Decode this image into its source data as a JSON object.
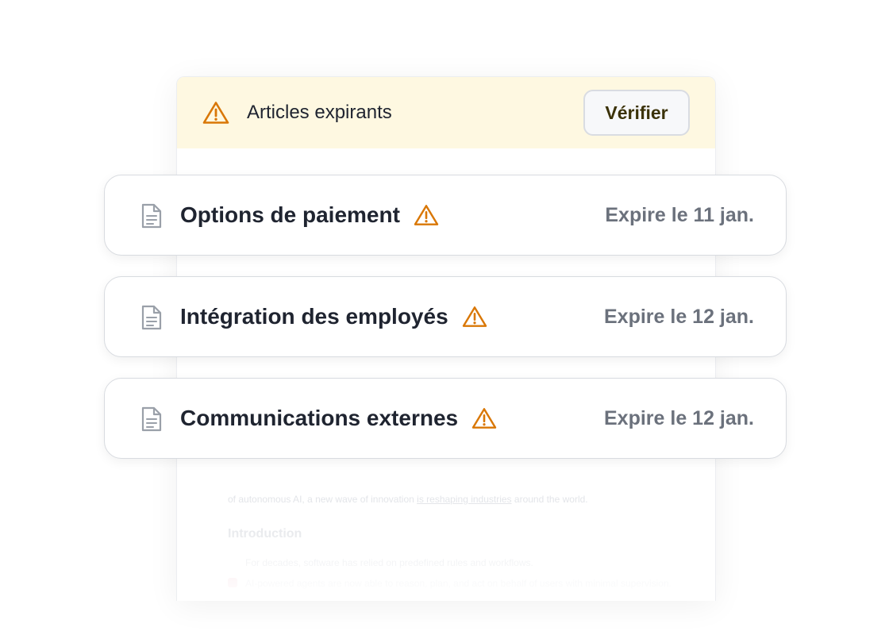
{
  "banner": {
    "title": "Articles expirants",
    "icon": "warning-icon",
    "button_label": "Vérifier"
  },
  "articles": [
    {
      "title": "Options de paiement",
      "expires": "Expire le 11 jan.",
      "icon": "document-icon",
      "status_icon": "warning-icon"
    },
    {
      "title": "Intégration des employés",
      "expires": "Expire le 12 jan.",
      "icon": "document-icon",
      "status_icon": "warning-icon"
    },
    {
      "title": "Communications externes",
      "expires": "Expire le 12 jan.",
      "icon": "document-icon",
      "status_icon": "warning-icon"
    }
  ],
  "background_document": {
    "line1_pre": "of autonomous AI, a new wave of innovation ",
    "line1_link": "is reshaping industries",
    "line1_post": " around the world.",
    "heading": "Introduction",
    "para1": "For decades, software has relied on predefined rules and workflows.",
    "para2": "AI-powered agents are now able to reason, plan, and act on behalf of users with minimal supervision."
  },
  "colors": {
    "banner_bg": "#fef8e1",
    "warning": "#d97706",
    "title_text": "#1f2430",
    "date_text": "#6b717c",
    "card_border": "#d8dbe0"
  }
}
